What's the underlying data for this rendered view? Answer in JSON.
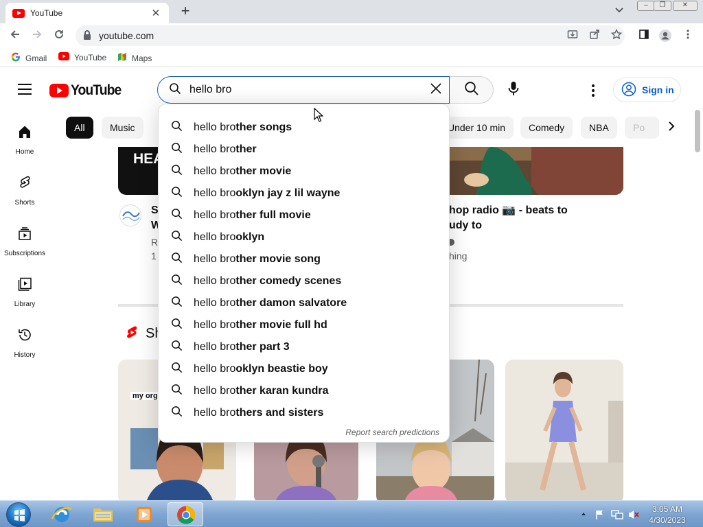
{
  "browser": {
    "tab_title": "YouTube",
    "tab_close": "✕",
    "new_tab": "+",
    "tab_search": "⌄",
    "url": "youtube.com",
    "bookmarks": [
      {
        "label": "Gmail",
        "icon": "google-icon"
      },
      {
        "label": "YouTube",
        "icon": "youtube-icon"
      },
      {
        "label": "Maps",
        "icon": "maps-icon"
      }
    ]
  },
  "youtube": {
    "logo_text": "YouTube",
    "search": {
      "value": "hello bro",
      "placeholder": "Search"
    },
    "sign_in": "Sign in",
    "chips": [
      "All",
      "Music",
      "Under 10 min",
      "Comedy",
      "NBA",
      "Po"
    ],
    "side_nav": [
      {
        "label": "Home",
        "icon": "home-icon"
      },
      {
        "label": "Shorts",
        "icon": "shorts-icon"
      },
      {
        "label": "Subscriptions",
        "icon": "subscriptions-icon"
      },
      {
        "label": "Library",
        "icon": "library-icon"
      },
      {
        "label": "History",
        "icon": "history-icon"
      }
    ],
    "videos": [
      {
        "thumb_text": "HEA",
        "title_line1": "S",
        "title_line2": "W",
        "channel": "R",
        "meta": "1"
      },
      {
        "title_line1": "hop radio 📷 - beats to",
        "title_line2": "udy to",
        "meta": "hing"
      }
    ],
    "shorts_heading": "Sh",
    "short_overlay": "my org"
  },
  "suggestions": {
    "typed": "hello bro",
    "items": [
      {
        "prefix": "hello bro",
        "rest": "ther songs"
      },
      {
        "prefix": "hello bro",
        "rest": "ther"
      },
      {
        "prefix": "hello bro",
        "rest": "ther movie"
      },
      {
        "prefix": "hello bro",
        "rest": "oklyn jay z lil wayne"
      },
      {
        "prefix": "hello bro",
        "rest": "ther full movie"
      },
      {
        "prefix": "hello bro",
        "rest": "oklyn"
      },
      {
        "prefix": "hello bro",
        "rest": "ther movie song"
      },
      {
        "prefix": "hello bro",
        "rest": "ther comedy scenes"
      },
      {
        "prefix": "hello bro",
        "rest": "ther damon salvatore"
      },
      {
        "prefix": "hello bro",
        "rest": "ther movie full hd"
      },
      {
        "prefix": "hello bro",
        "rest": "ther part 3"
      },
      {
        "prefix": "hello bro",
        "rest": "oklyn beastie boy"
      },
      {
        "prefix": "hello bro",
        "rest": "ther karan kundra"
      },
      {
        "prefix": "hello bro",
        "rest": "thers and sisters"
      }
    ],
    "report_label": "Report search predictions"
  },
  "taskbar": {
    "time": "3:05 AM",
    "date": "4/30/2023"
  },
  "colors": {
    "accent_blue": "#065fd4",
    "youtube_red": "#ff0000",
    "search_border": "#1c62b9"
  }
}
